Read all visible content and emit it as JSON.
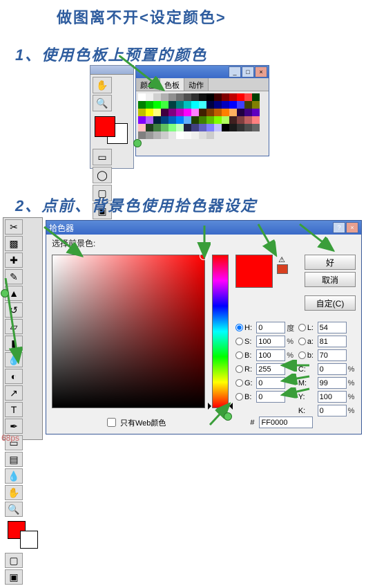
{
  "heading": {
    "text": "做图离不开<设定颜色>"
  },
  "section1": {
    "title": "1、使用色板上预置的颜色"
  },
  "section2": {
    "title": "2、点前、背景色使用拾色器设定"
  },
  "swatches": {
    "tabs": [
      "颜色",
      "色板",
      "动作"
    ],
    "active_tab": 1,
    "fg_color": "#ff0000",
    "bg_color": "#ffffff"
  },
  "picker": {
    "title": "拾色器",
    "label": "选择前景色:",
    "buttons": {
      "ok": "好",
      "cancel": "取消",
      "custom": "自定(C)"
    },
    "web_only": "只有Web颜色",
    "preview": "#ff0000",
    "warn_swatch": "#d84020",
    "fields": {
      "H": {
        "label": "H:",
        "val": "0",
        "unit": "度"
      },
      "S": {
        "label": "S:",
        "val": "100",
        "unit": "%"
      },
      "Br": {
        "label": "B:",
        "val": "100",
        "unit": "%"
      },
      "L": {
        "label": "L:",
        "val": "54",
        "unit": ""
      },
      "a": {
        "label": "a:",
        "val": "81",
        "unit": ""
      },
      "b": {
        "label": "b:",
        "val": "70",
        "unit": ""
      },
      "R": {
        "label": "R:",
        "val": "255",
        "unit": ""
      },
      "G": {
        "label": "G:",
        "val": "0",
        "unit": ""
      },
      "B": {
        "label": "B:",
        "val": "0",
        "unit": ""
      },
      "C": {
        "label": "C:",
        "val": "0",
        "unit": "%"
      },
      "M": {
        "label": "M:",
        "val": "99",
        "unit": "%"
      },
      "Y": {
        "label": "Y:",
        "val": "100",
        "unit": "%"
      },
      "K": {
        "label": "K:",
        "val": "0",
        "unit": "%"
      }
    },
    "hex_label": "#",
    "hex": "FF0000"
  },
  "icons": {
    "hand": "✋",
    "zoom": "🔍",
    "crop": "✂",
    "eyedrop": "💧",
    "text": "T",
    "move": "✥",
    "lasso": "◯",
    "erase": "▱",
    "pen": "✎"
  },
  "swatch_colors": [
    "#ffffff",
    "#f0f0f0",
    "#d0d0d0",
    "#b0b0b0",
    "#909090",
    "#707070",
    "#505050",
    "#303030",
    "#101010",
    "#000000",
    "#400000",
    "#800000",
    "#c00000",
    "#ff0000",
    "#ff4040",
    "#004000",
    "#008000",
    "#00c000",
    "#00ff00",
    "#40ff40",
    "#004040",
    "#008080",
    "#00c0c0",
    "#00ffff",
    "#40ffff",
    "#000040",
    "#000080",
    "#0000c0",
    "#0000ff",
    "#4040ff",
    "#404000",
    "#808000",
    "#c0c000",
    "#ffff00",
    "#ffff80",
    "#400040",
    "#800080",
    "#c000c0",
    "#ff00ff",
    "#ff80ff",
    "#402000",
    "#804000",
    "#c06000",
    "#ff8000",
    "#ffb060",
    "#200040",
    "#400080",
    "#6000c0",
    "#8000ff",
    "#b060ff",
    "#002040",
    "#004080",
    "#0060c0",
    "#0080ff",
    "#60b0ff",
    "#204000",
    "#408000",
    "#60c000",
    "#80ff00",
    "#b0ff60",
    "#402020",
    "#804040",
    "#c06060",
    "#ff8080",
    "#ffc0c0",
    "#204020",
    "#408040",
    "#60c060",
    "#80ff80",
    "#c0ffc0",
    "#202040",
    "#404080",
    "#6060c0",
    "#8080ff",
    "#c0c0ff",
    "#000000",
    "#1a1a1a",
    "#333333",
    "#4d4d4d",
    "#666666",
    "#808080",
    "#999999",
    "#b3b3b3",
    "#cccccc",
    "#e6e6e6",
    "#ffffff",
    "#f8f8f8",
    "#eeeeee",
    "#dddddd",
    "#cccccc"
  ],
  "watermark": "68ps"
}
